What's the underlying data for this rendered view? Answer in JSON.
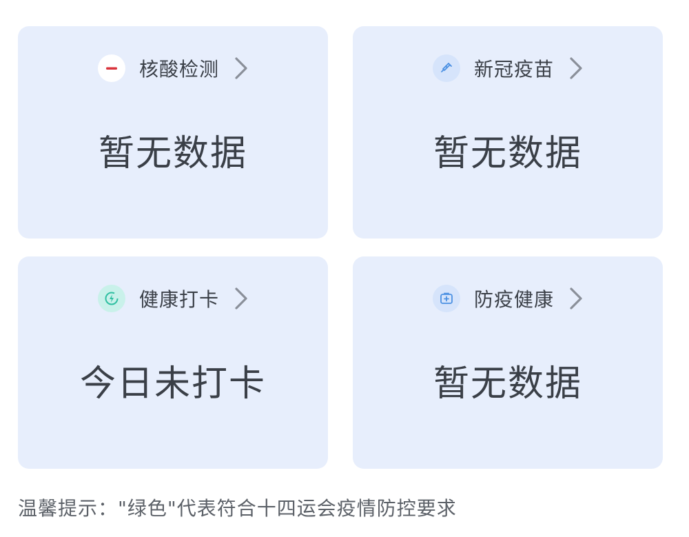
{
  "cards": [
    {
      "label": "核酸检测",
      "value": "暂无数据",
      "icon": "minus-circle-icon",
      "icon_bg": "#ffffff",
      "icon_color": "#d9343c"
    },
    {
      "label": "新冠疫苗",
      "value": "暂无数据",
      "icon": "syringe-icon",
      "icon_bg": "#d6e4fb",
      "icon_color": "#4a90e2"
    },
    {
      "label": "健康打卡",
      "value": "今日未打卡",
      "icon": "lightning-circle-icon",
      "icon_bg": "#c9f1ea",
      "icon_color": "#2fbfa1"
    },
    {
      "label": "防疫健康",
      "value": "暂无数据",
      "icon": "medical-kit-icon",
      "icon_bg": "#d6e4fb",
      "icon_color": "#4a90e2"
    }
  ],
  "tip": "温馨提示：\"绿色\"代表符合十四运会疫情防控要求",
  "colors": {
    "card_bg": "#e7eefc",
    "text": "#3a3f47",
    "chevron": "#8a8f99"
  }
}
